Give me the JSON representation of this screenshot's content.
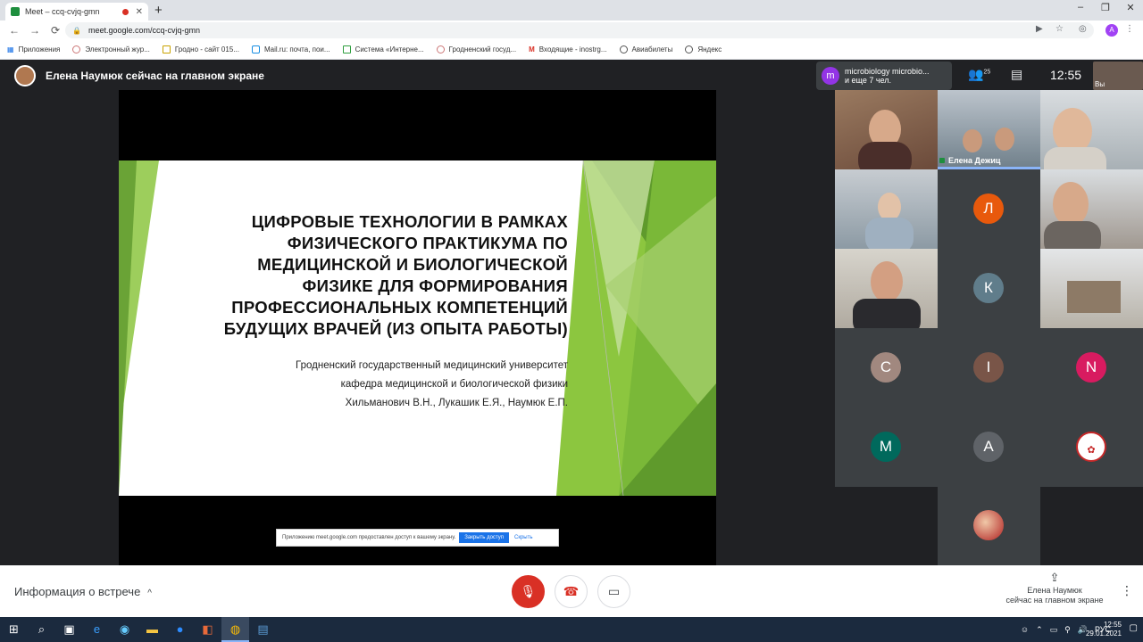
{
  "browser": {
    "tab_title": "Meet – ccq-cvjq-gmn",
    "tab_close": "✕",
    "new_tab": "+",
    "window_controls": [
      "–",
      "❐",
      "✕"
    ],
    "nav": [
      "←",
      "→",
      "⟳"
    ],
    "url": "meet.google.com/ccq-cvjq-gmn",
    "profile_initial": "A",
    "bookmarks": [
      "Приложения",
      "Электронный жур...",
      "Гродно - сайт 015...",
      "Mail.ru: почта, пои...",
      "Система «Интерне...",
      "Гродненский госуд...",
      "Входящие - inostrg...",
      "Авиабилеты",
      "Яндекс"
    ]
  },
  "meet": {
    "presenter_banner": "Елена Наумюк сейчас на главном экране",
    "slide": {
      "title_lines": [
        "ЦИФРОВЫЕ ТЕХНОЛОГИИ В РАМКАХ",
        "ФИЗИЧЕСКОГО ПРАКТИКУМА ПО",
        "МЕДИЦИНСКОЙ И БИОЛОГИЧЕСКОЙ",
        "ФИЗИКЕ ДЛЯ ФОРМИРОВАНИЯ",
        "ПРОФЕССИОНАЛЬНЫХ КОМПЕТЕНЦИЙ",
        "БУДУЩИХ ВРАЧЕЙ (ИЗ ОПЫТА РАБОТЫ)"
      ],
      "subtitle_lines": [
        "Гродненский государственный медицинский университет",
        "кафедра медицинской и биологической физики",
        "Хильманович В.Н., Лукашик Е.Я., Наумюк Е.П."
      ],
      "colors": {
        "green_dark": "#5f9a2c",
        "green_mid": "#8cc63f",
        "green_light": "#c5e0a0"
      }
    },
    "share_bar": {
      "text": "Приложению meet.google.com предоставлен доступ к вашему экрану.",
      "stop_label": "Закрыть доступ",
      "hide_label": "Скрыть"
    },
    "chat_notice": {
      "avatar": "m",
      "line1": "microbiology microbio...",
      "line2": "и еще 7 чел."
    },
    "participants_count": "25",
    "clock": "12:55",
    "self_label": "Вы",
    "tiles": [
      {
        "type": "video",
        "name": ""
      },
      {
        "type": "video",
        "name": "Елена Дежиц",
        "speaking": true
      },
      {
        "type": "video",
        "name": ""
      },
      {
        "type": "video",
        "name": ""
      },
      {
        "type": "letter",
        "letter": "Л",
        "color": "#e8590c"
      },
      {
        "type": "video",
        "name": ""
      },
      {
        "type": "video",
        "name": ""
      },
      {
        "type": "letter",
        "letter": "К",
        "color": "#607d8b"
      },
      {
        "type": "video",
        "name": ""
      },
      {
        "type": "letter",
        "letter": "С",
        "color": "#a1887f"
      },
      {
        "type": "letter",
        "letter": "I",
        "color": "#795548"
      },
      {
        "type": "letter",
        "letter": "N",
        "color": "#d81b60"
      },
      {
        "type": "letter",
        "letter": "М",
        "color": "#00695c"
      },
      {
        "type": "letter",
        "letter": "А",
        "color": "#5f6368"
      },
      {
        "type": "logo",
        "letter": ""
      },
      {
        "type": "photo",
        "letter": ""
      }
    ]
  },
  "bottom": {
    "info_label": "Информация о встрече",
    "info_chevron": "^",
    "mic_icon": "mic-off",
    "hangup_icon": "call-end",
    "camera_icon": "videocam",
    "present_line1": "Елена Наумюк",
    "present_line2": "сейчас на главном экране",
    "more": "⋮"
  },
  "taskbar": {
    "tray_lang": "РУС",
    "time": "12:55",
    "date": "29.01.2021"
  }
}
